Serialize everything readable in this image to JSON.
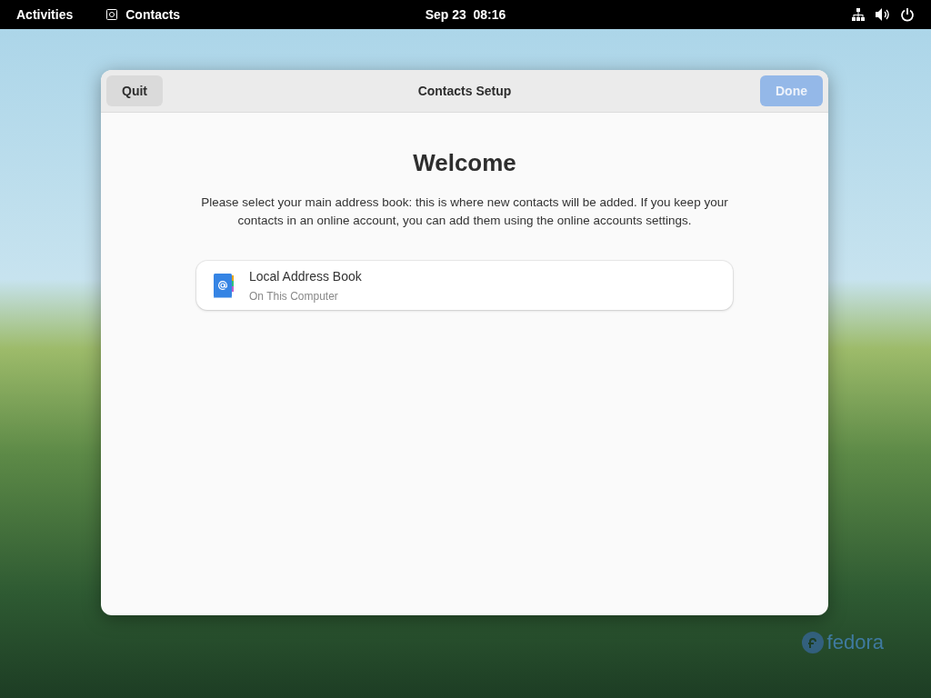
{
  "top_bar": {
    "activities": "Activities",
    "app_name": "Contacts",
    "clock": "Sep 23  08:16"
  },
  "window": {
    "title": "Contacts Setup",
    "quit_button": {
      "label": "Quit",
      "disabled": false
    },
    "done_button": {
      "label": "Done",
      "disabled": true
    }
  },
  "welcome": {
    "heading": "Welcome",
    "description": "Please select your main address book: this is where new contacts will be added. If you keep your contacts in an online account, you can add them using the online accounts settings."
  },
  "address_books": [
    {
      "name": "Local Address Book",
      "subtitle": "On This Computer"
    }
  ],
  "desktop": {
    "logo_text": "fedora"
  }
}
